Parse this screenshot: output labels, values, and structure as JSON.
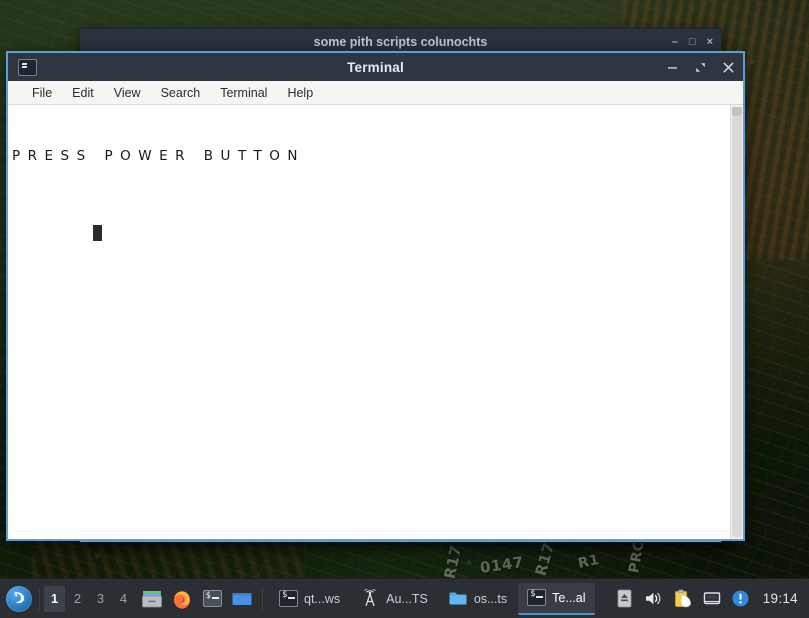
{
  "desktop": {
    "wallpaper_description": "circuit-board-photo-wallpaper",
    "wallpaper_colors": {
      "green": "#20301a",
      "dark": "#0d1608",
      "copper": "#b06830"
    },
    "silkscreen_labels": [
      "R17",
      "0147",
      "R17",
      "R1",
      "PRO"
    ]
  },
  "background_window": {
    "title": "some pith scripts colunochts",
    "titlebar_color": "#2b3340",
    "controls": {
      "minimize": "–",
      "maximize": "□",
      "close": "×"
    },
    "statusbar_segments": [
      "",
      "",
      "",
      "",
      ""
    ]
  },
  "terminal": {
    "title": "Terminal",
    "app_icon": "terminal-icon",
    "border_color": "#5a9fd4",
    "titlebar_color": "#2f3640",
    "controls": {
      "minimize": {
        "name": "minimize-button",
        "glyph": "–"
      },
      "maximize": {
        "name": "maximize-button",
        "glyph": "⤡"
      },
      "close": {
        "name": "close-button",
        "glyph": "×"
      }
    },
    "menubar": [
      {
        "label": "File",
        "name": "menu-file"
      },
      {
        "label": "Edit",
        "name": "menu-edit"
      },
      {
        "label": "View",
        "name": "menu-view"
      },
      {
        "label": "Search",
        "name": "menu-search"
      },
      {
        "label": "Terminal",
        "name": "menu-terminal"
      },
      {
        "label": "Help",
        "name": "menu-help"
      }
    ],
    "screen": {
      "background": "#ffffff",
      "foreground": "#181818",
      "lines": [
        "PRESS POWER BUTTON"
      ],
      "cursor_visible": true
    },
    "scrollbar": {
      "name": "terminal-scrollbar",
      "position": "top"
    }
  },
  "taskbar": {
    "background": "#2b2e33",
    "launcher": {
      "name": "applications-menu",
      "icon": "xfce-mouse-icon"
    },
    "workspaces": [
      {
        "label": "1",
        "active": true
      },
      {
        "label": "2",
        "active": false
      },
      {
        "label": "3",
        "active": false
      },
      {
        "label": "4",
        "active": false
      }
    ],
    "quick_launchers": [
      {
        "name": "file-manager-icon",
        "icon": "archive-drawer-icon"
      },
      {
        "name": "firefox-icon",
        "icon": "firefox-icon"
      },
      {
        "name": "terminal-launcher-icon",
        "icon": "terminal-prompt-icon"
      },
      {
        "name": "text-editor-icon",
        "icon": "blue-window-icon"
      }
    ],
    "windows": [
      {
        "label": "qt...ws",
        "icon": "terminal-icon",
        "active": false
      },
      {
        "label": "Au...TS",
        "icon": "antenna-icon",
        "active": false
      },
      {
        "label": "os...ts",
        "icon": "folder-icon",
        "active": false
      },
      {
        "label": "Te...al",
        "icon": "terminal-icon",
        "active": true
      }
    ],
    "systray": [
      {
        "name": "eject-media-icon",
        "icon": "eject-icon"
      },
      {
        "name": "volume-icon",
        "icon": "speaker-icon"
      },
      {
        "name": "clipboard-manager-icon",
        "icon": "clipboard-icon"
      },
      {
        "name": "network-icon",
        "icon": "network-icon"
      },
      {
        "name": "notification-badge",
        "icon": "alert-exclamation-icon"
      }
    ],
    "clock": "19:14"
  }
}
